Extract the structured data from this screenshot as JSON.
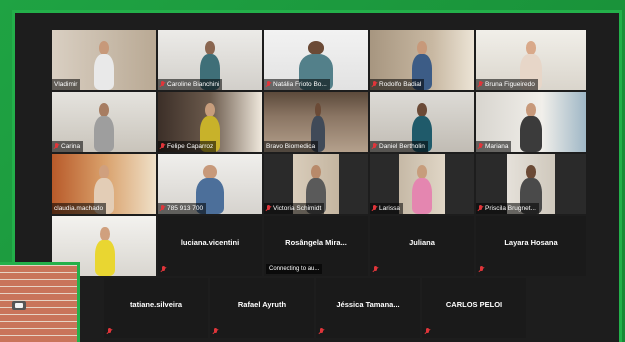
{
  "colors": {
    "accent_green": "#23b04a",
    "muted_red": "#e0353a",
    "active_border": "#d8e84a"
  },
  "video_tiles": [
    {
      "name": "Vladimir",
      "muted": false
    },
    {
      "name": "Caroline Bianchini",
      "muted": true
    },
    {
      "name": "Natália Frioto Bo...",
      "muted": true
    },
    {
      "name": "Rodolfo Badial",
      "muted": true
    },
    {
      "name": "Bruna Figueiredo",
      "muted": true
    },
    {
      "name": "Carina",
      "muted": true
    },
    {
      "name": "Felipe Caparroz",
      "muted": true
    },
    {
      "name": "Bravo Biomedica",
      "muted": false,
      "active": true
    },
    {
      "name": "Daniel Bertholin",
      "muted": true
    },
    {
      "name": "Mariana",
      "muted": true
    },
    {
      "name": "claudia.machado",
      "muted": false
    },
    {
      "name": "785 913 700",
      "muted": true
    },
    {
      "name": "Victoria Schimidt",
      "muted": true
    },
    {
      "name": "Larissa",
      "muted": true
    },
    {
      "name": "Priscila Brugnet...",
      "muted": true
    },
    {
      "name": "",
      "muted": true
    }
  ],
  "blank_tiles": [
    {
      "name": "luciana.vicentini",
      "connecting": ""
    },
    {
      "name": "Rosângela Mira...",
      "connecting": "Connecting to au..."
    },
    {
      "name": "Juliana",
      "connecting": ""
    },
    {
      "name": "Layara Hosana",
      "connecting": ""
    },
    {
      "name": "tatiane.silveira",
      "connecting": ""
    },
    {
      "name": "Rafael Ayruth",
      "connecting": ""
    },
    {
      "name": "Jéssica Tamana...",
      "connecting": ""
    },
    {
      "name": "CARLOS PELOI",
      "connecting": ""
    }
  ]
}
